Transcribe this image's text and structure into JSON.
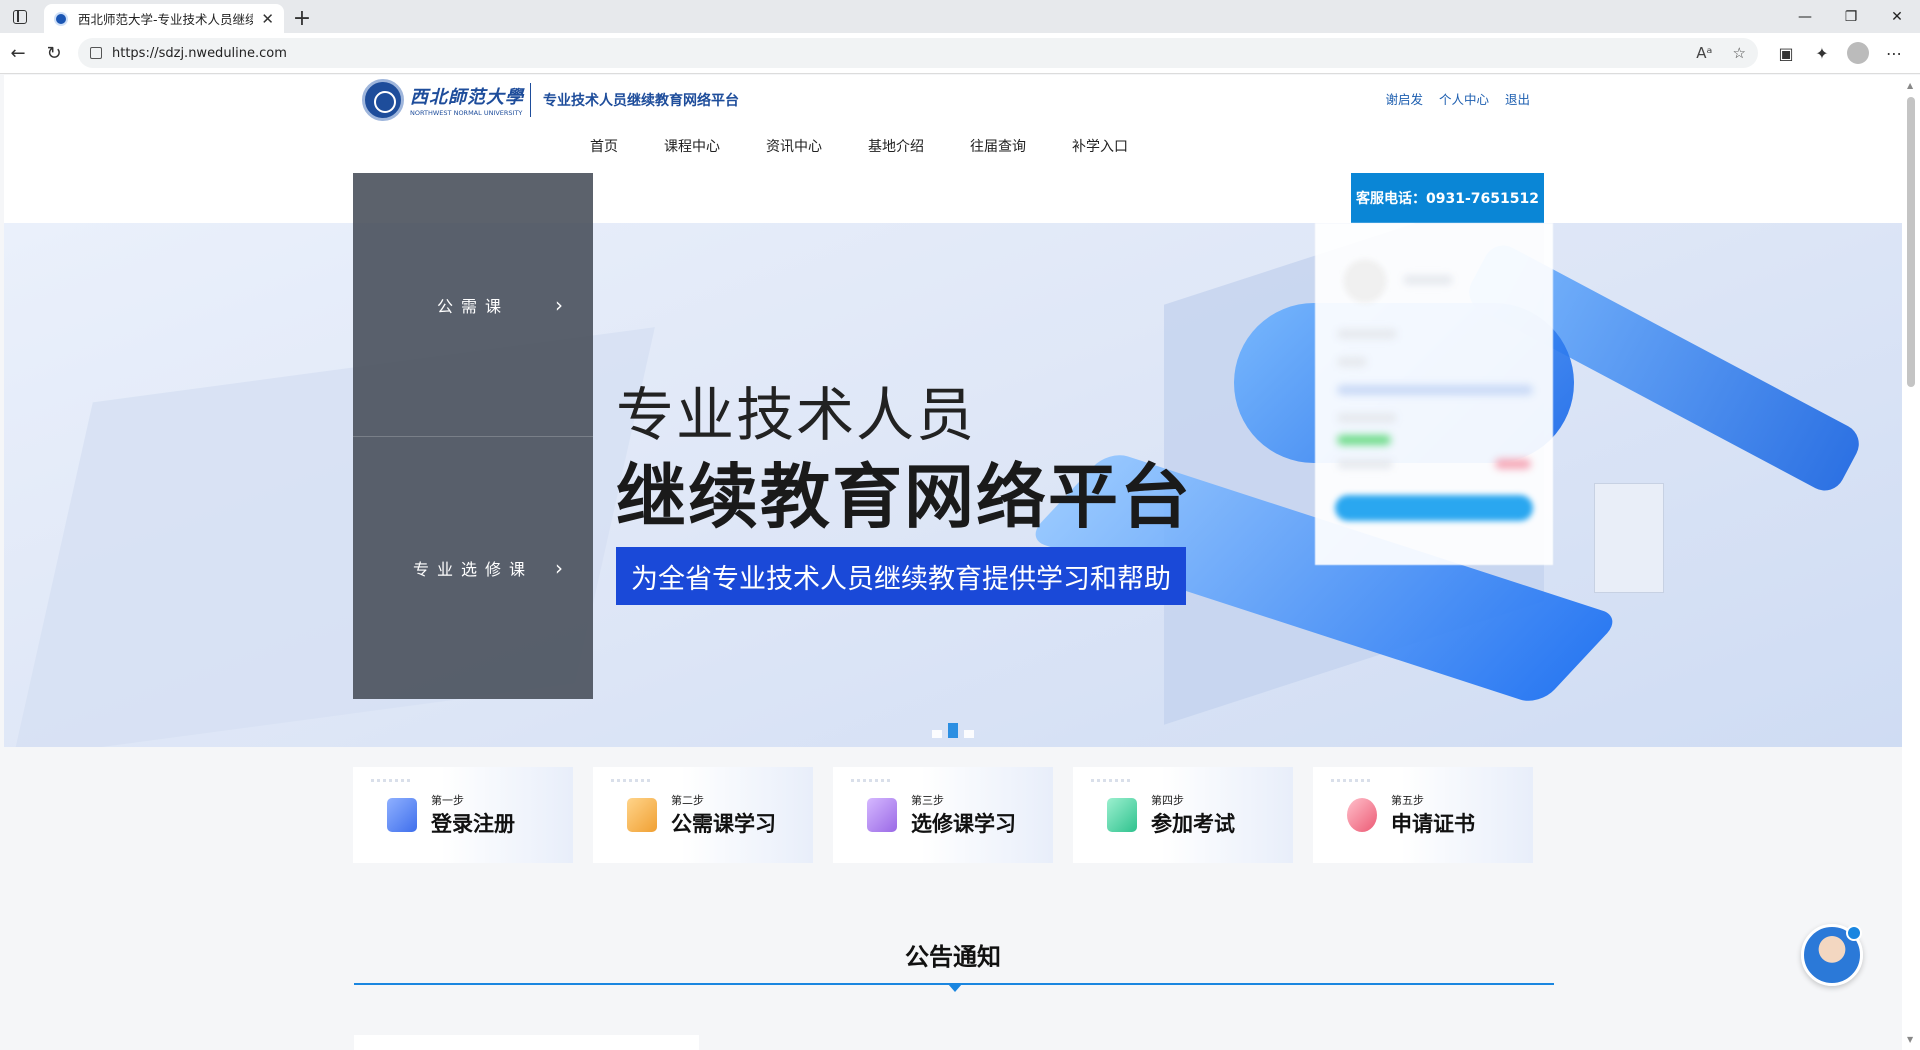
{
  "browser": {
    "tab_title": "西北师范大学-专业技术人员继续",
    "tab_close": "✕",
    "new_tab": "+",
    "url": "https://sdzj.nweduline.com",
    "window_controls": [
      "—",
      "❐",
      "✕"
    ]
  },
  "header": {
    "logo_cn": "西北師范大學",
    "logo_en": "NORTHWEST NORMAL UNIVERSITY",
    "platform_name": "专业技术人员继续教育网络平台",
    "top_links": [
      "谢启发",
      "个人中心",
      "退出"
    ],
    "nav": [
      "首页",
      "课程中心",
      "资讯中心",
      "基地介绍",
      "往届查询",
      "补学入口"
    ],
    "hotline": "客服电话：0931-7651512"
  },
  "hero": {
    "title1": "专业技术人员",
    "title2": "继续教育网络平台",
    "subtitle": "为全省专业技术人员继续教育提供学习和帮助",
    "slide_active": 2
  },
  "side_menu": [
    {
      "label": "公需课",
      "chevron": "›"
    },
    {
      "label": "专业选修课",
      "chevron": "›"
    }
  ],
  "steps": [
    {
      "step": "第一步",
      "label": "登录注册",
      "color": "#4a7bf0"
    },
    {
      "step": "第二步",
      "label": "公需课学习",
      "color": "#f2b04a"
    },
    {
      "step": "第三步",
      "label": "选修课学习",
      "color": "#a77ae8"
    },
    {
      "step": "第四步",
      "label": "参加考试",
      "color": "#3ccf9b"
    },
    {
      "step": "第五步",
      "label": "申请证书",
      "color": "#f06a7e"
    }
  ],
  "notice": {
    "title": "公告通知"
  }
}
